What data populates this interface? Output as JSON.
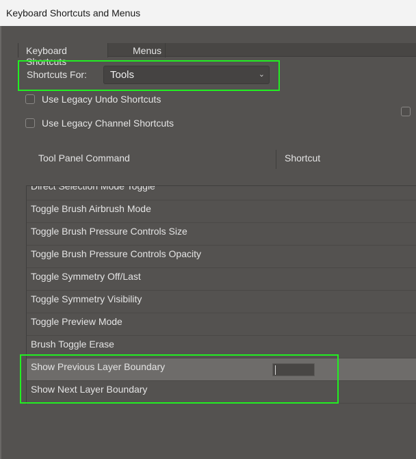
{
  "window": {
    "title": "Keyboard Shortcuts and Menus"
  },
  "tabs": [
    {
      "label": "Keyboard Shortcuts"
    },
    {
      "label": "Menus"
    }
  ],
  "shortcuts_for": {
    "label": "Shortcuts For:",
    "value": "Tools"
  },
  "options": [
    {
      "label": "Use Legacy Undo Shortcuts",
      "checked": false
    },
    {
      "label": "Use Legacy Channel Shortcuts",
      "checked": false
    }
  ],
  "table": {
    "headers": [
      "Tool Panel Command",
      "Shortcut"
    ],
    "rows": [
      {
        "command": "Direct Selection Mode Toggle",
        "shortcut": ""
      },
      {
        "command": "Toggle Brush Airbrush Mode",
        "shortcut": ""
      },
      {
        "command": "Toggle Brush Pressure Controls Size",
        "shortcut": ""
      },
      {
        "command": "Toggle Brush Pressure Controls Opacity",
        "shortcut": ""
      },
      {
        "command": "Toggle Symmetry Off/Last",
        "shortcut": ""
      },
      {
        "command": "Toggle Symmetry Visibility",
        "shortcut": ""
      },
      {
        "command": "Toggle Preview Mode",
        "shortcut": ""
      },
      {
        "command": "Brush Toggle Erase",
        "shortcut": ""
      },
      {
        "command": "Show Previous Layer Boundary",
        "shortcut": "",
        "selected": true
      },
      {
        "command": "Show Next Layer Boundary",
        "shortcut": ""
      }
    ]
  },
  "colors": {
    "highlight": "#22ee22",
    "background": "#545250",
    "selected_row": "#6e6c6a"
  }
}
